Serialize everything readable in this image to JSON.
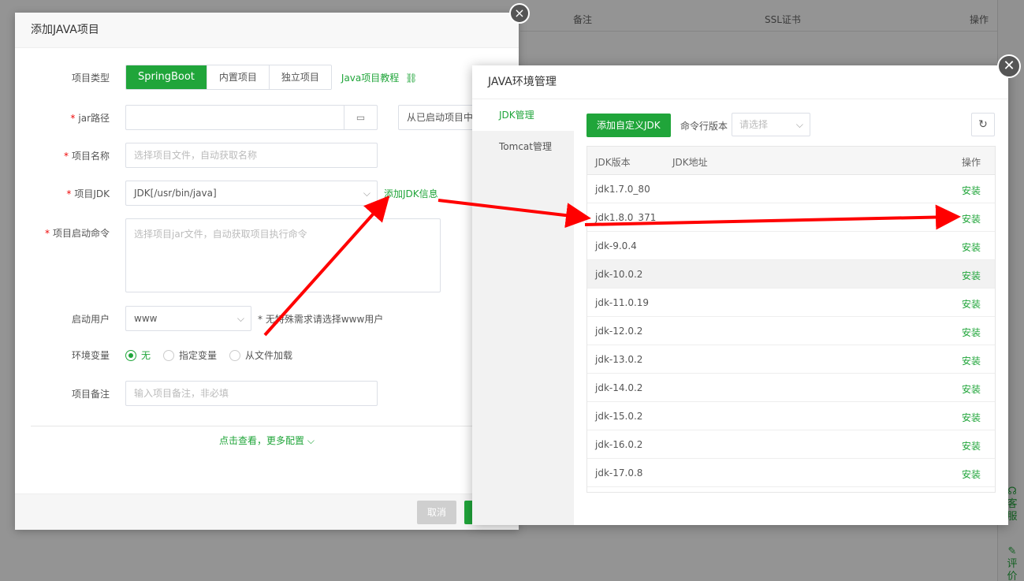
{
  "background": {
    "table_headers": [
      "备注",
      "SSL证书",
      "操作"
    ],
    "rail": [
      "客服",
      "评价"
    ]
  },
  "add_project_dialog": {
    "title": "添加JAVA项目",
    "close_icon": "×",
    "project_type": {
      "label": "项目类型",
      "options": [
        "SpringBoot",
        "内置项目",
        "独立项目"
      ],
      "selected": "SpringBoot",
      "tutorial_link": "Java项目教程"
    },
    "jar_path": {
      "label": "jar路径",
      "value": "",
      "from_started_placeholder": "从已启动项目中"
    },
    "project_name": {
      "label": "项目名称",
      "placeholder": "选择项目文件，自动获取名称"
    },
    "project_jdk": {
      "label": "项目JDK",
      "value": "JDK[/usr/bin/java]",
      "add_link": "添加JDK信息"
    },
    "start_command": {
      "label": "项目启动命令",
      "placeholder": "选择项目jar文件，自动获取项目执行命令"
    },
    "start_user": {
      "label": "启动用户",
      "value": "www",
      "hint": "* 无特殊需求请选择www用户"
    },
    "env_vars": {
      "label": "环境变量",
      "options": [
        "无",
        "指定变量",
        "从文件加载"
      ],
      "selected": "无"
    },
    "remark": {
      "label": "项目备注",
      "placeholder": "输入项目备注，非必填"
    },
    "more_config": "点击查看，更多配置",
    "cancel_label": "取消"
  },
  "java_env_dialog": {
    "title": "JAVA环境管理",
    "tabs": [
      "JDK管理",
      "Tomcat管理"
    ],
    "active_tab": "JDK管理",
    "add_custom_jdk": "添加自定义JDK",
    "cmd_version_label": "命令行版本",
    "cmd_version_placeholder": "请选择",
    "table": {
      "headers": [
        "JDK版本",
        "JDK地址",
        "操作"
      ],
      "rows": [
        {
          "version": "jdk1.7.0_80",
          "action": "安装"
        },
        {
          "version": "jdk1.8.0_371",
          "action": "安装"
        },
        {
          "version": "jdk-9.0.4",
          "action": "安装"
        },
        {
          "version": "jdk-10.0.2",
          "action": "安装"
        },
        {
          "version": "jdk-11.0.19",
          "action": "安装"
        },
        {
          "version": "jdk-12.0.2",
          "action": "安装"
        },
        {
          "version": "jdk-13.0.2",
          "action": "安装"
        },
        {
          "version": "jdk-14.0.2",
          "action": "安装"
        },
        {
          "version": "jdk-15.0.2",
          "action": "安装"
        },
        {
          "version": "jdk-16.0.2",
          "action": "安装"
        },
        {
          "version": "jdk-17.0.8",
          "action": "安装"
        }
      ]
    }
  },
  "colors": {
    "accent": "#20a53a",
    "annotation": "#ff0000"
  }
}
